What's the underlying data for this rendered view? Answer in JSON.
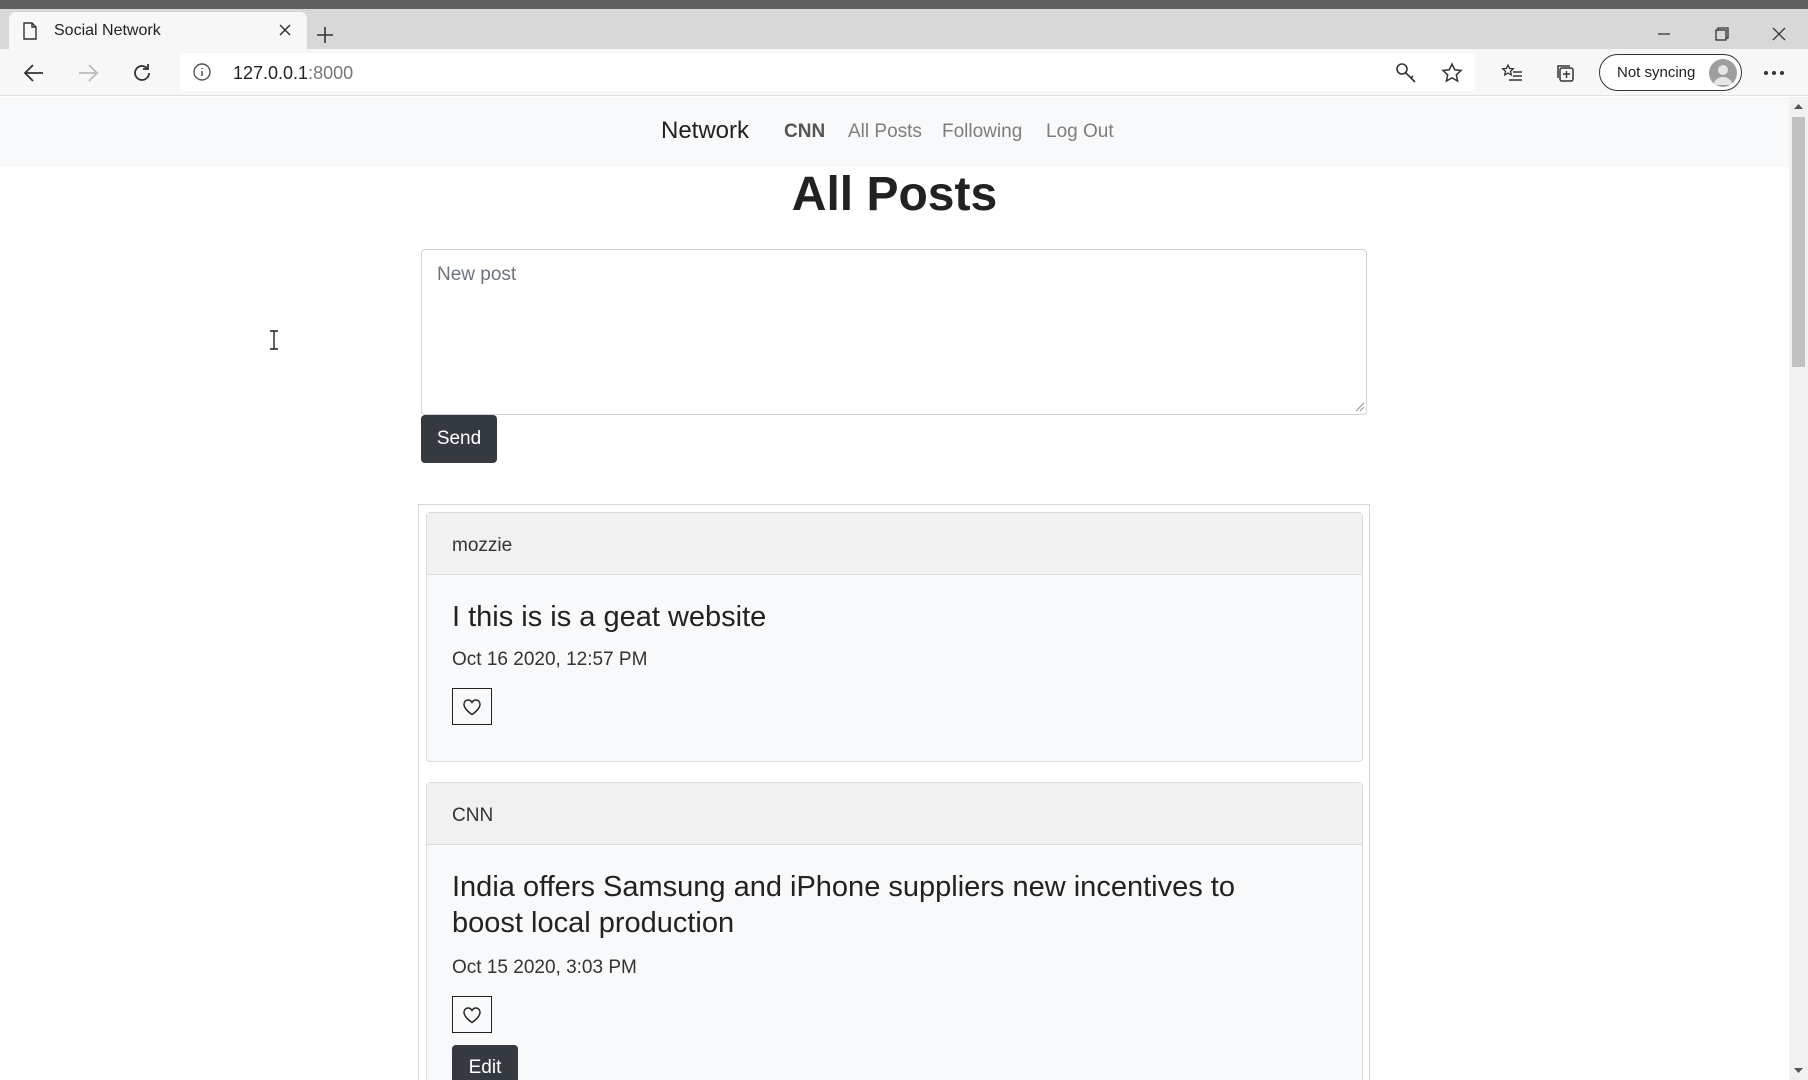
{
  "browser": {
    "tab_title": "Social Network",
    "url_host": "127.0.0.1",
    "url_port": ":8000",
    "sync_label": "Not syncing",
    "icons": [
      "page-icon",
      "close-icon",
      "plus-icon",
      "minimize-icon",
      "restore-icon",
      "back-icon",
      "forward-icon",
      "reload-icon",
      "info-icon",
      "key-icon",
      "star-icon",
      "favorites-icon",
      "collections-icon",
      "avatar-icon",
      "more-icon"
    ]
  },
  "navbar": {
    "brand": "Network",
    "user": "CNN",
    "links": [
      "All Posts",
      "Following",
      "Log Out"
    ]
  },
  "page": {
    "title": "All Posts",
    "new_post_placeholder": "New post",
    "send_label": "Send"
  },
  "posts": [
    {
      "author": "mozzie",
      "text": "I this is is a geat website",
      "date": "Oct 16 2020, 12:57 PM",
      "editable": false
    },
    {
      "author": "CNN",
      "text": "India offers Samsung and iPhone suppliers new incentives to boost local production",
      "date": "Oct 15 2020, 3:03 PM",
      "editable": true,
      "edit_label": "Edit"
    }
  ]
}
